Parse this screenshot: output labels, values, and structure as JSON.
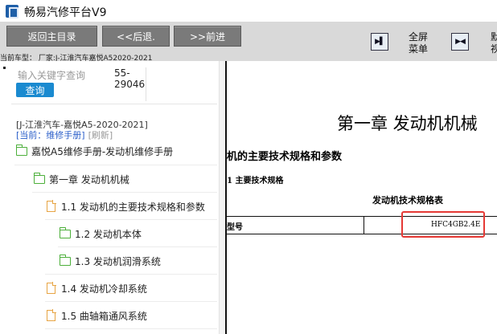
{
  "app": {
    "title": "畅易汽修平台V9"
  },
  "toolbar": {
    "home_label": "返回主目录",
    "back_label": "<<后退.",
    "forward_label": ">>前进",
    "fullscreen_line1": "全屏",
    "fullscreen_line2": "菜单",
    "cut_line1": "默",
    "cut_line2": "视",
    "vehicle_text": "当前车型： 厂家:J-江淮汽车嘉悦A52020-2021"
  },
  "search": {
    "placeholder": "输入关键字查询",
    "query_label": "查询",
    "code_line1": "55-",
    "code_line2": "29046"
  },
  "tree": {
    "model_line": "[J-江淮汽车-嘉悦A5-2020-2021]",
    "current_label": "[当前：维修手册]",
    "refresh_label": "[刷新]",
    "items": [
      {
        "label": "嘉悦A5维修手册-发动机维修手册",
        "icon": "folder-icon"
      },
      {
        "label": "第一章 发动机机械",
        "icon": "folder-icon"
      },
      {
        "label": "1.1 发动机的主要技术规格和参数",
        "icon": "document-icon"
      },
      {
        "label": "1.2 发动机本体",
        "icon": "folder-icon"
      },
      {
        "label": "1.3 发动机润滑系统",
        "icon": "folder-icon"
      },
      {
        "label": "1.4 发动机冷却系统",
        "icon": "document-icon"
      },
      {
        "label": "1.5 曲轴箱通风系统",
        "icon": "document-icon"
      }
    ]
  },
  "document": {
    "chapter_title": "第一章 发动机机械",
    "section_title": "机的主要技术规格和参数",
    "subsection_title": "1 主要技术规格",
    "table_caption": "发动机技术规格表",
    "row_key": "型号",
    "row_value": "HFC4GB2.4E",
    "highlight_color": "#e53935"
  }
}
